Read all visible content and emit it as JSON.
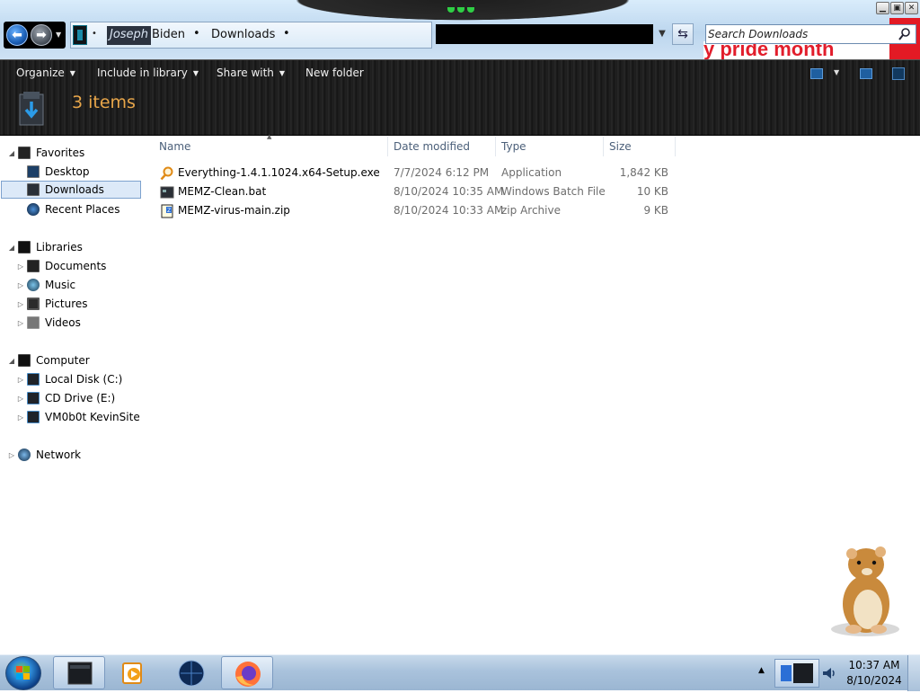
{
  "window": {
    "breadcrumb": {
      "user_first": "Joseph",
      "user_last": "Biden",
      "folder": "Downloads",
      "separator": "•"
    },
    "search": {
      "placeholder": "Search Downloads"
    },
    "background_banner": "y pride month",
    "controls": {
      "minimize": "▁",
      "maximize": "▣",
      "close": "✕"
    }
  },
  "commands": {
    "organize": "Organize",
    "include_in_library": "Include in library",
    "share_with": "Share with",
    "new_folder": "New folder"
  },
  "details": {
    "item_count": "3 items"
  },
  "nav": {
    "favorites": {
      "label": "Favorites",
      "items": [
        {
          "label": "Desktop",
          "icon": "desktop-icon"
        },
        {
          "label": "Downloads",
          "icon": "downloads-icon",
          "selected": true
        },
        {
          "label": "Recent Places",
          "icon": "recent-places-icon"
        }
      ]
    },
    "libraries": {
      "label": "Libraries",
      "items": [
        {
          "label": "Documents",
          "icon": "documents-icon"
        },
        {
          "label": "Music",
          "icon": "music-icon"
        },
        {
          "label": "Pictures",
          "icon": "pictures-icon"
        },
        {
          "label": "Videos",
          "icon": "videos-icon"
        }
      ]
    },
    "computer": {
      "label": "Computer",
      "items": [
        {
          "label": "Local Disk (C:)",
          "icon": "drive-icon"
        },
        {
          "label": "CD Drive (E:)",
          "icon": "cd-drive-icon"
        },
        {
          "label": "VM0b0t KevinSite",
          "icon": "network-drive-icon"
        }
      ]
    },
    "network": {
      "label": "Network"
    }
  },
  "file_list": {
    "columns": {
      "name": "Name",
      "date": "Date modified",
      "type": "Type",
      "size": "Size"
    },
    "files": [
      {
        "name": "Everything-1.4.1.1024.x64-Setup.exe",
        "date": "7/7/2024 6:12 PM",
        "type": "Application",
        "size": "1,842 KB",
        "icon": "search-app-icon"
      },
      {
        "name": "MEMZ-Clean.bat",
        "date": "8/10/2024 10:35 AM",
        "type": "Windows Batch File",
        "size": "10 KB",
        "icon": "batch-file-icon"
      },
      {
        "name": "MEMZ-virus-main.zip",
        "date": "8/10/2024 10:33 AM",
        "type": "zip Archive",
        "size": "9 KB",
        "icon": "zip-file-icon"
      }
    ]
  },
  "taskbar": {
    "clock_time": "10:37 AM",
    "clock_date": "8/10/2024"
  },
  "colors": {
    "accent_orange": "#e8a64a",
    "command_bar": "#1c1c1c",
    "taskbar": "#a9c2dc",
    "banner_red": "#e21d2b"
  }
}
